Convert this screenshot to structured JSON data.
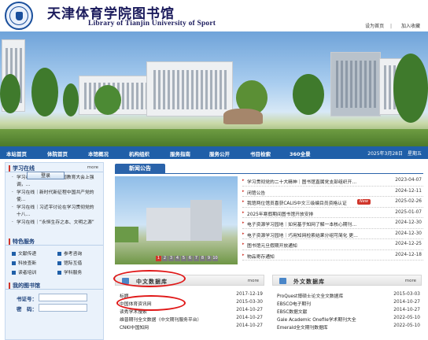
{
  "header": {
    "title_cn": "天津体育学院图书馆",
    "title_en": "Library of Tianjin University of Sport",
    "links": [
      "设为首页",
      "加入收藏"
    ]
  },
  "nav": {
    "items": [
      "本站首页",
      "体院首页",
      "本馆概况",
      "机构组织",
      "服务指南",
      "服务公开",
      "书目检索",
      "360全景"
    ],
    "date": "2025年3月28日　星期五"
  },
  "study": {
    "title": "学习在线",
    "more": "more",
    "items": [
      "学习在线｜习近平在全国教育大会上强调，…",
      "学习在线｜新时代新征程中国共产党的使…",
      "学习在线｜习近平讨论在学习贯彻党的十八…",
      "学习在线｜“永恒生存之本、文明之源”"
    ]
  },
  "services": {
    "title": "特色服务",
    "items": [
      "文献传递",
      "参考咨询",
      "科技查新",
      "馆际互借",
      "读者培训",
      "学科服务"
    ]
  },
  "mylib": {
    "title": "我的图书馆",
    "card_label": "书证号：",
    "pwd_label": "密　码：",
    "login_label": "登录"
  },
  "news": {
    "tab": "新闻公告",
    "pager": [
      "1",
      "2",
      "3",
      "4",
      "5",
      "6",
      "7",
      "8",
      "9",
      "10"
    ],
    "rows": [
      {
        "title": "学习贯彻党的二十大精神｜图书馆直属党支部组织开…",
        "date": "2023-04-07"
      },
      {
        "title": "闭馆公告",
        "date": "2024-12-11"
      },
      {
        "title": "我馆两位馆员喜获CALIS中文三级编目员资格认证",
        "date": "2025-02-26",
        "badge": "New"
      },
      {
        "title": "2025年寒假期间图书馆开放安排",
        "date": "2025-01-07"
      },
      {
        "title": "电子资源学习园地｜如何基于知网了解一本核心期刊…",
        "date": "2024-12-30"
      },
      {
        "title": "电子资源学习园地｜巧用知网检索结果分组可简化 更…",
        "date": "2024-12-30"
      },
      {
        "title": "图书馆元旦假期开放通知",
        "date": "2024-12-25"
      },
      {
        "title": "物品寄存通知",
        "date": "2024-12-18"
      }
    ]
  },
  "db_cn": {
    "title": "中文数据库",
    "more": "more",
    "rows": [
      {
        "title": "标题",
        "date": "2017-12-19"
      },
      {
        "title": "中国体育资讯网",
        "date": "2015-03-30"
      },
      {
        "title": "读秀学术搜索",
        "date": "2014-10-27"
      },
      {
        "title": "维普期刊全文数据（中文期刊服务平台）",
        "date": "2014-10-27"
      },
      {
        "title": "CNKI中国知网",
        "date": "2014-10-27"
      }
    ]
  },
  "db_en": {
    "title": "外文数据库",
    "more": "more",
    "rows": [
      {
        "title": "ProQuest博硕士论文全文数据库",
        "date": "2015-03-03"
      },
      {
        "title": "EBSCO电子期刊",
        "date": "2014-10-27"
      },
      {
        "title": "EBSC数据文献",
        "date": "2014-10-27"
      },
      {
        "title": "Gale Academic Onefile学术期刊大全",
        "date": "2022-05-10"
      },
      {
        "title": "Emerald全文期刊数据库",
        "date": "2022-05-10"
      }
    ]
  }
}
